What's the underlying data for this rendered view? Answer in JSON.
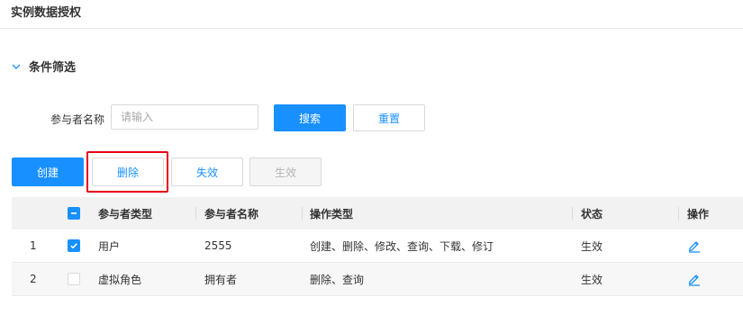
{
  "page": {
    "title": "实例数据授权"
  },
  "filter": {
    "section_label": "条件筛选",
    "participant_name_label": "参与者名称",
    "search_placeholder": "请输入",
    "search_value": "",
    "search_button": "搜索",
    "reset_button": "重置"
  },
  "toolbar": {
    "create": "创建",
    "delete": "删除",
    "invalidate": "失效",
    "validate": "生效"
  },
  "table": {
    "headers": {
      "participant_type": "参与者类型",
      "participant_name": "参与者名称",
      "operation_type": "操作类型",
      "status": "状态",
      "action": "操作"
    },
    "rows": [
      {
        "index": "1",
        "checked": true,
        "participant_type": "用户",
        "participant_name": "2555",
        "operation_type": "创建、删除、修改、查询、下载、修订",
        "status": "生效"
      },
      {
        "index": "2",
        "checked": false,
        "participant_type": "虚拟角色",
        "participant_name": "拥有者",
        "operation_type": "删除、查询",
        "status": "生效"
      }
    ]
  },
  "colors": {
    "primary": "#1890ff",
    "highlight": "#e60012",
    "header_bg": "#f2f2f2"
  },
  "icons": {
    "collapse": "chevron-down-icon",
    "edit": "edit-pencil-icon",
    "check": "check-icon",
    "partial": "minus-icon"
  }
}
